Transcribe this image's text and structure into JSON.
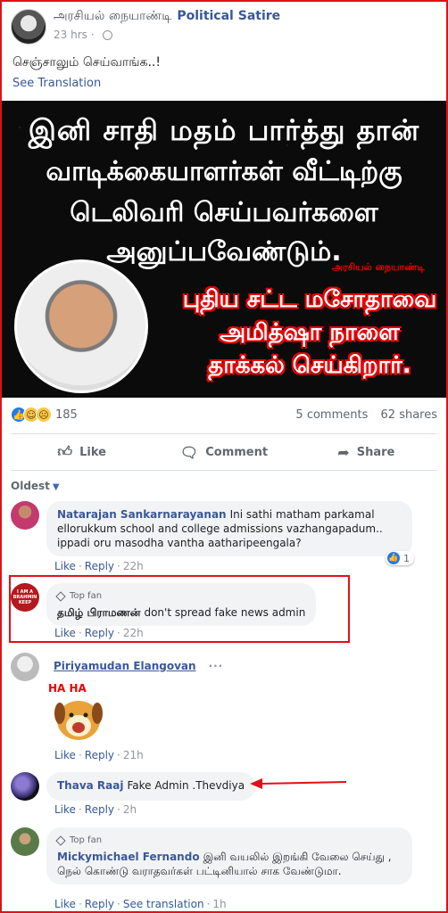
{
  "post": {
    "page_name_tamil": "அரசியல் நையாண்டி",
    "page_name": "Political Satire",
    "time": "23 hrs",
    "dot": "·",
    "text": "செஞ்சாலும் செய்வாங்க..!",
    "see_translation": "See Translation",
    "image": {
      "line1": "இனி சாதி மதம் பார்த்து தான்",
      "line2": "வாடிக்கையாளர்கள் வீட்டிற்கு",
      "line3": "டெலிவரி செய்பவர்களை",
      "line4": "அனுப்பவேண்டும்.",
      "credit": "அரசியல் நையாண்டி",
      "red1": "புதிய சட்ட மசோதாவை",
      "red2": "அமித்ஷா நாளை",
      "red3": "தாக்கல் செய்கிறார்."
    },
    "reaction_count": "185",
    "comments_count": "5 comments",
    "shares_count": "62 shares",
    "reaction_icons": [
      "like-icon",
      "haha-icon",
      "sad-icon"
    ]
  },
  "actions": {
    "like": "Like",
    "comment": "Comment",
    "share": "Share"
  },
  "sort": {
    "label": "Oldest"
  },
  "comments": [
    {
      "name": "Natarajan Sankarnarayanan",
      "text": "Ini sathi matham parkamal ellorukkum school and college admissions vazhangapadum.. ippadi oru masodha vantha aatharipeengala?",
      "like": "Like",
      "reply": "Reply",
      "time": "22h",
      "likes": "1"
    },
    {
      "badge": "Top fan",
      "name": "தமிழ் பிராமணன்",
      "text": "don't spread fake news admin",
      "like": "Like",
      "reply": "Reply",
      "time": "22h",
      "avatar_text": "I AM A BRAHMIN KEEP"
    },
    {
      "name": "Piriyamudan Elangovan",
      "more": "···",
      "sticker_text": "HA HA",
      "like": "Like",
      "reply": "Reply",
      "time": "21h"
    },
    {
      "name": "Thava Raaj",
      "text": "Fake Admin .Thevdiya",
      "like": "Like",
      "reply": "Reply",
      "time": "2h"
    },
    {
      "badge": "Top fan",
      "name": "Mickymichael Fernando",
      "text": "இனி வயலில் இறங்கி வேலை செய்து , நெல் கொண்டு வராதவர்கள் பட்டினியால் சாக வேண்டுமா.",
      "like": "Like",
      "reply": "Reply",
      "see_translation": "See translation",
      "time": "1h"
    }
  ],
  "colors": {
    "annotation_red": "#e0101a",
    "link_blue": "#385898",
    "like_blue": "#2078f4",
    "bubble_bg": "#f2f3f5"
  }
}
